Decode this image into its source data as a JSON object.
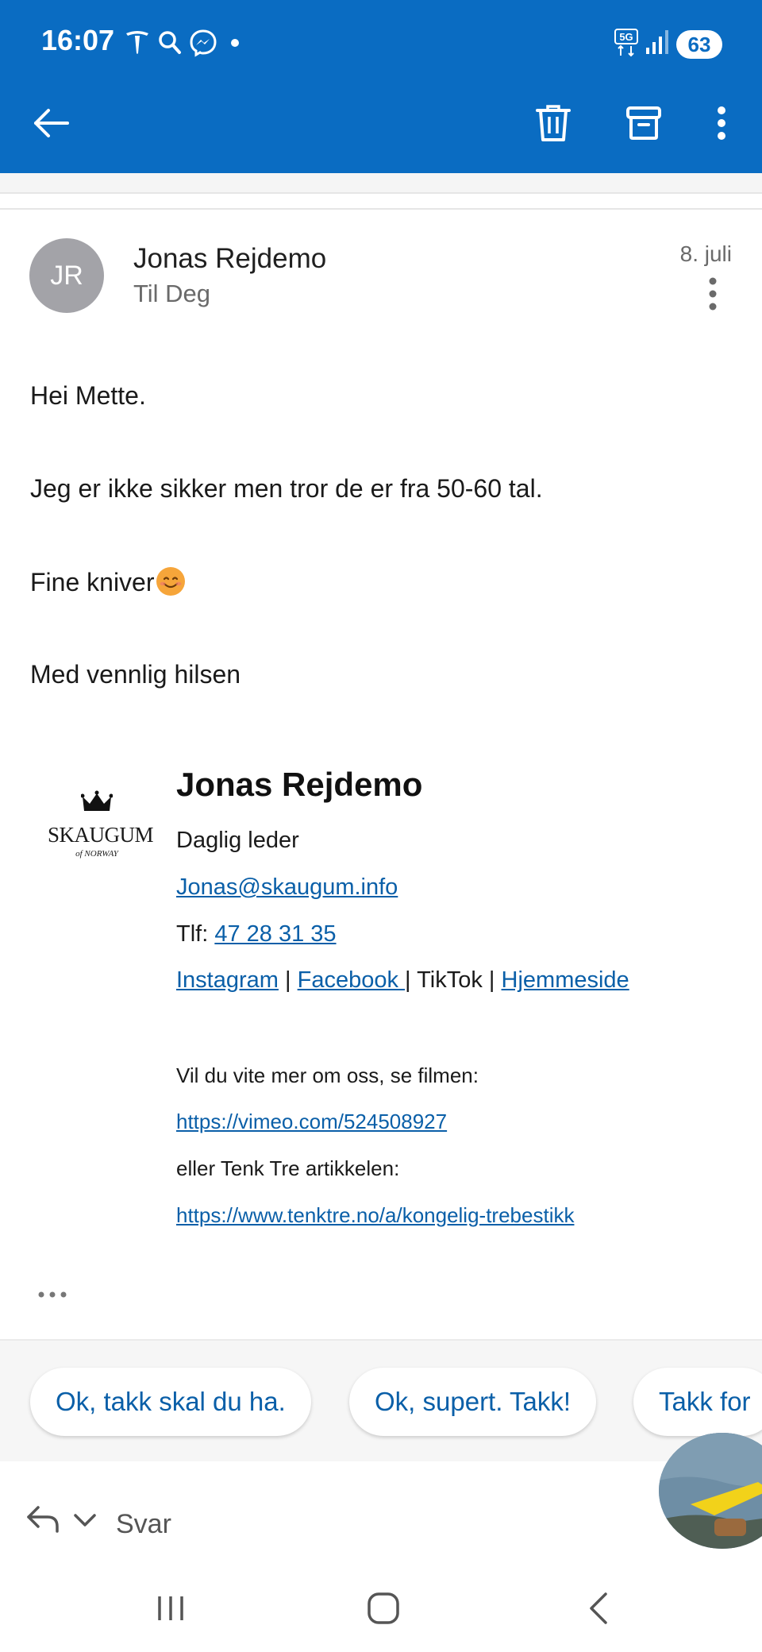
{
  "status_bar": {
    "time": "16:07",
    "battery": "63",
    "network": "5G",
    "icons": [
      "tesla-icon",
      "search-icon",
      "messenger-icon",
      "dot-icon",
      "5g-icon",
      "signal-icon"
    ]
  },
  "toolbar": {
    "back_icon": "arrow-left-icon",
    "delete_icon": "trash-icon",
    "archive_icon": "archive-icon",
    "more_icon": "more-vertical-icon"
  },
  "colors": {
    "accent": "#0a6cc2",
    "link": "#0a5fa8",
    "avatar": "#a3a3a8"
  },
  "message": {
    "avatar_initials": "JR",
    "sender": "Jonas Rejdemo",
    "recipient": "Til Deg",
    "date": "8. juli",
    "body": [
      "Hei Mette.",
      "Jeg er ikke sikker men tror de er fra 50-60 tal.",
      "Fine kniver",
      "Med vennlig hilsen"
    ],
    "emoji": "smiling-face-emoji"
  },
  "signature": {
    "logo_text": "SKAUGUM",
    "logo_sub": "of NORWAY",
    "name": "Jonas Rejdemo",
    "title": "Daglig leder",
    "email": "Jonas@skaugum.info",
    "phone_label": "Tlf:",
    "phone": "47 28 31 35",
    "links": {
      "instagram": "Instagram",
      "facebook": "Facebook ",
      "tiktok": "TikTok",
      "homepage": "Hjemmeside",
      "separator": "|"
    },
    "video_intro": "Vil du vite mer om oss, se filmen:",
    "video_url": "https://vimeo.com/524508927",
    "article_intro": "eller Tenk Tre artikkelen:",
    "article_url": "https://www.tenktre.no/a/kongelig-trebestikk"
  },
  "quick_replies": [
    "Ok, takk skal du ha.",
    "Ok, supert. Takk!",
    "Takk for"
  ],
  "reply_bar": {
    "label": "Svar"
  }
}
